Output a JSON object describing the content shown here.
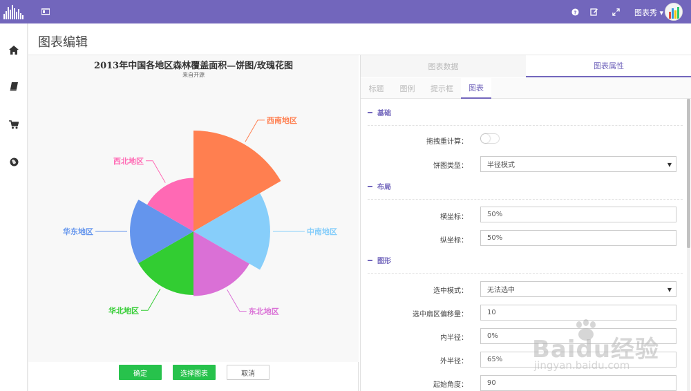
{
  "topbar": {
    "user_name": "图表秀 ▾",
    "accent_color": "#7266bc"
  },
  "sidebar": {
    "items": [
      "home-icon",
      "book-icon",
      "cart-icon",
      "globe-icon"
    ]
  },
  "page": {
    "title": "图表编辑"
  },
  "chart_panel": {
    "buttons": {
      "confirm": "确定",
      "select_chart": "选择图表",
      "cancel": "取消"
    }
  },
  "chart_data": {
    "type": "pie",
    "variant": "rose-radius",
    "title": "2013年中国各地区森林覆盖面积—饼图/玫瑰花图",
    "subtitle": "来自开源",
    "start_angle": 90,
    "inner_radius": "0%",
    "outer_radius": "65%",
    "slices": [
      {
        "name": "西南地区",
        "radius": 1.0,
        "color": "#ff7f50"
      },
      {
        "name": "中南地区",
        "radius": 0.76,
        "color": "#87cefa"
      },
      {
        "name": "东北地区",
        "radius": 0.64,
        "color": "#da70d6"
      },
      {
        "name": "华北地区",
        "radius": 0.63,
        "color": "#32cd32"
      },
      {
        "name": "华东地区",
        "radius": 0.63,
        "color": "#6495ed"
      },
      {
        "name": "西北地区",
        "radius": 0.53,
        "color": "#ff69b4"
      }
    ]
  },
  "settings": {
    "main_tabs": [
      "图表数据",
      "图表属性"
    ],
    "sub_tabs": [
      "标题",
      "图例",
      "提示框",
      "图表"
    ],
    "sections": {
      "basic": "基础",
      "layout": "布局",
      "shape": "图形"
    },
    "fields": {
      "drag_recalc_label": "拖拽重计算：",
      "pie_type_label": "饼图类型：",
      "pie_type_value": "半径模式",
      "center_x_label": "横坐标：",
      "center_x_value": "50%",
      "center_y_label": "纵坐标：",
      "center_y_value": "50%",
      "select_mode_label": "选中模式：",
      "select_mode_value": "无法选中",
      "selected_offset_label": "选中扇区偏移量：",
      "selected_offset_value": "10",
      "inner_radius_label": "内半径：",
      "inner_radius_value": "0%",
      "outer_radius_label": "外半径：",
      "outer_radius_value": "65%",
      "start_angle_label": "起始角度：",
      "start_angle_value": "90"
    }
  },
  "watermark": {
    "brand": "Baidu经验",
    "url": "jingyan.baidu.com"
  }
}
